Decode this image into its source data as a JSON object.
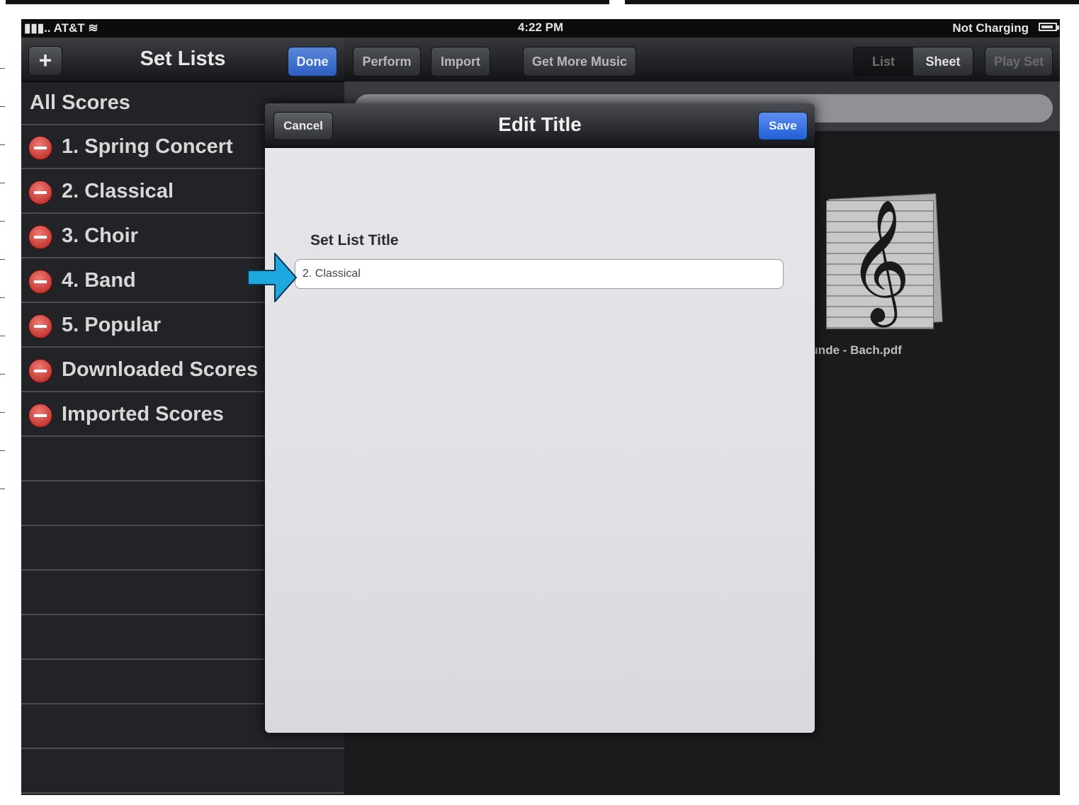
{
  "status_bar": {
    "carrier": "AT&T",
    "time": "4:22 PM",
    "charging_status": "Not Charging"
  },
  "sidebar": {
    "title": "Set Lists",
    "add_label": "+",
    "done_label": "Done",
    "all_scores": "All Scores",
    "items": [
      {
        "label": "1. Spring Concert"
      },
      {
        "label": "2. Classical"
      },
      {
        "label": "3. Choir"
      },
      {
        "label": "4. Band"
      },
      {
        "label": "5. Popular"
      },
      {
        "label": "Downloaded Scores"
      },
      {
        "label": "Imported Scores"
      }
    ]
  },
  "toolbar": {
    "perform": "Perform",
    "import": "Import",
    "get_more_music": "Get More Music",
    "view_list": "List",
    "view_sheet": "Sheet",
    "play_set": "Play Set",
    "selected_view": "Sheet"
  },
  "content": {
    "file_name": "erzens Grunde - Bach.pdf",
    "file_icon": "treble-clef-score-icon"
  },
  "modal": {
    "cancel": "Cancel",
    "title": "Edit Title",
    "save": "Save",
    "field_label": "Set List Title",
    "field_value": "2. Classical"
  },
  "colors": {
    "accent_blue": "#2c5fc4",
    "delete_red": "#c8302a",
    "callout_arrow": "#1ea8e0"
  }
}
